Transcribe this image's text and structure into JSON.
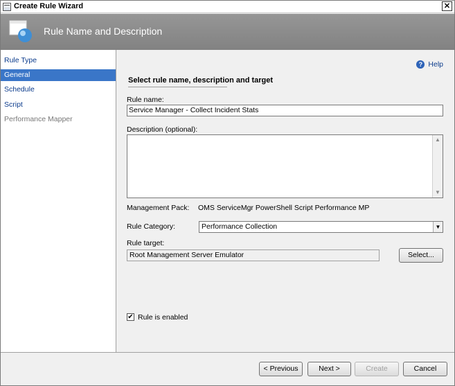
{
  "window": {
    "title": "Create Rule Wizard",
    "close_glyph": "✕"
  },
  "banner": {
    "title": "Rule Name and Description",
    "icon": "wizard-icon"
  },
  "nav": {
    "items": [
      {
        "label": "Rule Type",
        "state": "link"
      },
      {
        "label": "General",
        "state": "selected"
      },
      {
        "label": "Schedule",
        "state": "link"
      },
      {
        "label": "Script",
        "state": "link"
      },
      {
        "label": "Performance Mapper",
        "state": "disabled"
      }
    ]
  },
  "main": {
    "help_label": "Help",
    "section_title": "Select rule name, description and target",
    "rule_name": {
      "label": "Rule name:",
      "value": "Service Manager - Collect Incident Stats"
    },
    "description": {
      "label": "Description (optional):",
      "value": ""
    },
    "management_pack": {
      "label": "Management Pack:",
      "value": "OMS ServiceMgr PowerShell Script Performance MP"
    },
    "rule_category": {
      "label": "Rule Category:",
      "value": "Performance Collection"
    },
    "rule_target": {
      "label": "Rule target:",
      "value": "Root Management Server Emulator",
      "select_label": "Select..."
    },
    "enabled": {
      "label": "Rule is enabled",
      "checked": true,
      "check_glyph": "✔"
    }
  },
  "footer": {
    "previous_label": "< Previous",
    "next_label": "Next >",
    "create_label": "Create",
    "cancel_label": "Cancel"
  },
  "colors": {
    "banner": "#8c8c8c",
    "nav_selected": "#3a76c8",
    "link": "#0b3b8c"
  }
}
